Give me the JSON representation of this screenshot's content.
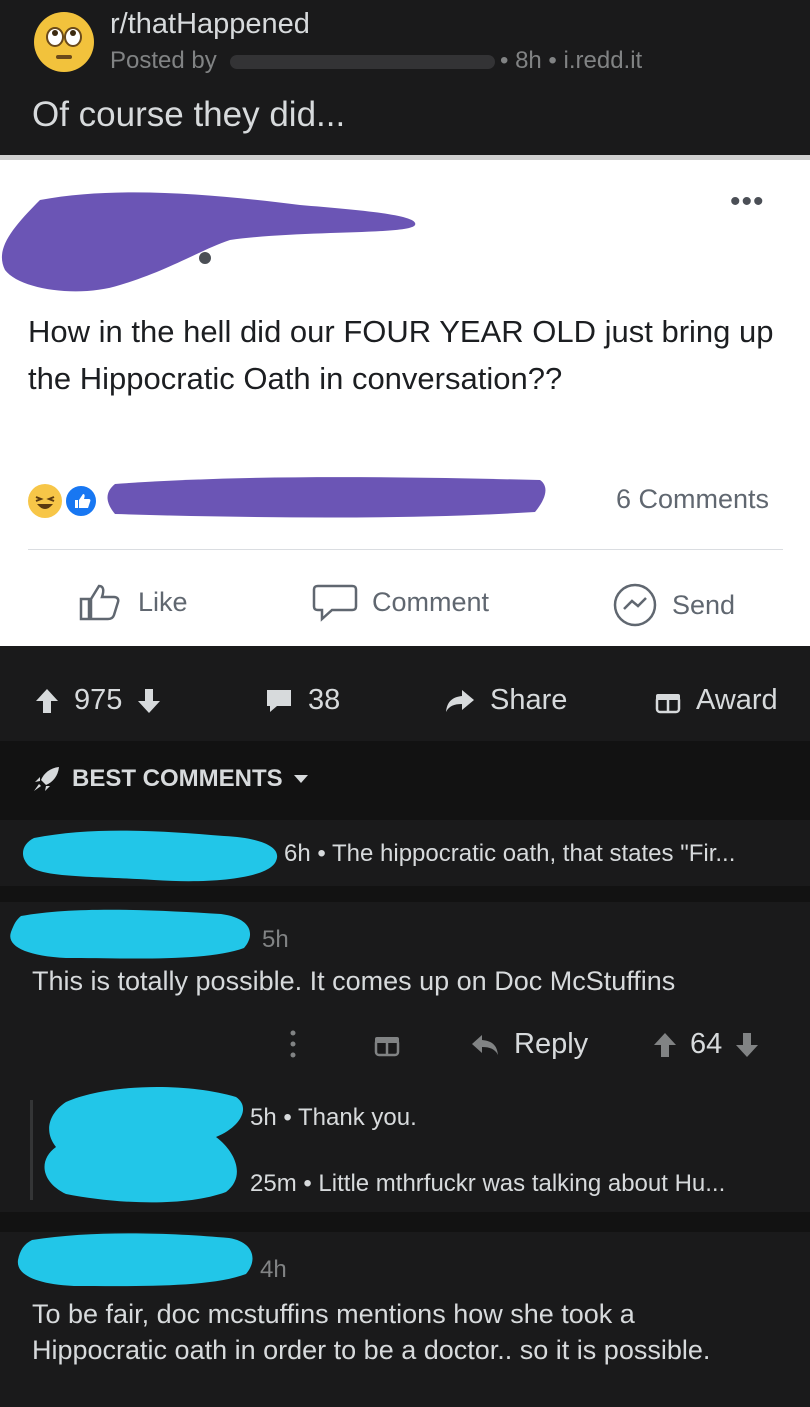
{
  "header": {
    "subreddit": "r/thatHappened",
    "posted_by": "Posted by",
    "meta": "• 8h • i.redd.it",
    "title": "Of course they did..."
  },
  "fb_post": {
    "more": "•••",
    "text": "How in the hell did our FOUR YEAR OLD just bring up the Hippocratic Oath in conversation??",
    "comments_count": "6 Comments",
    "like": "Like",
    "comment": "Comment",
    "send": "Send"
  },
  "actions": {
    "votes": "975",
    "comments": "38",
    "share": "Share",
    "award": "Award"
  },
  "sort": {
    "label": "BEST COMMENTS"
  },
  "comments": [
    {
      "meta": "6h • The hippocratic oath, that states \"Fir..."
    },
    {
      "time": "5h",
      "text": "This is totally possible. It comes up on Doc McStuffins",
      "reply": "Reply",
      "votes": "64"
    },
    {
      "meta": "5h • Thank you."
    },
    {
      "meta": "25m • Little mthrfuckr was talking about Hu..."
    },
    {
      "time": "4h",
      "text": "To be fair, doc mcstuffins mentions how she took a Hippocratic oath in order to be a doctor.. so it is possible."
    }
  ],
  "colors": {
    "redaction_purple": "#6b55b5",
    "redaction_cyan": "#22c6e8",
    "fb_blue": "#1877f2"
  }
}
